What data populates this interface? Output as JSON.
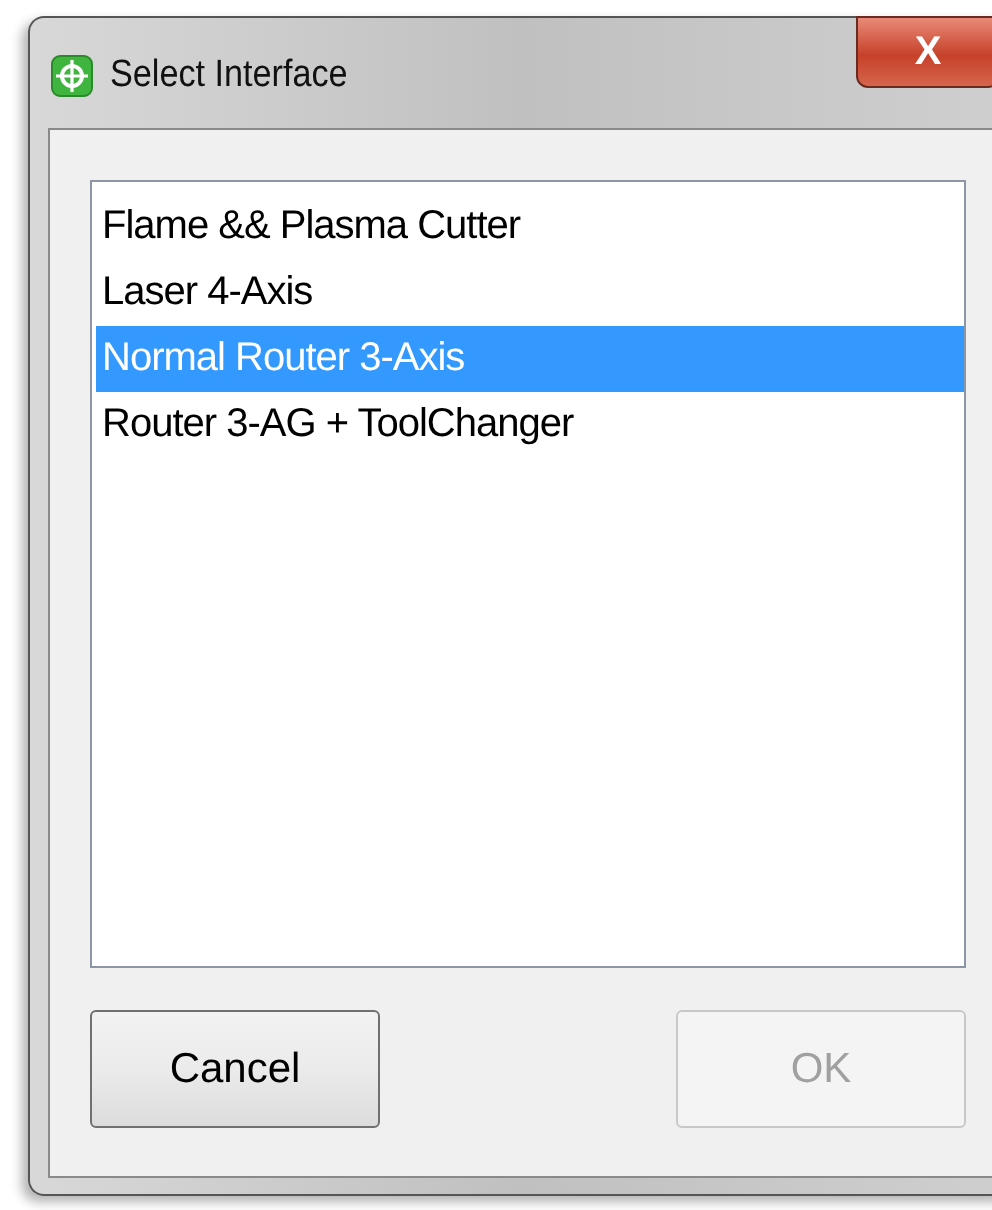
{
  "window": {
    "title": "Select Interface"
  },
  "close_button": {
    "label": "X"
  },
  "list": {
    "items": [
      {
        "label": "Flame && Plasma Cutter",
        "selected": false
      },
      {
        "label": "Laser 4-Axis",
        "selected": false
      },
      {
        "label": "Normal Router 3-Axis",
        "selected": true
      },
      {
        "label": "Router 3-AG + ToolChanger",
        "selected": false
      }
    ]
  },
  "buttons": [
    {
      "label": "Cancel",
      "disabled": false
    },
    {
      "label": "OK",
      "disabled": true
    }
  ]
}
